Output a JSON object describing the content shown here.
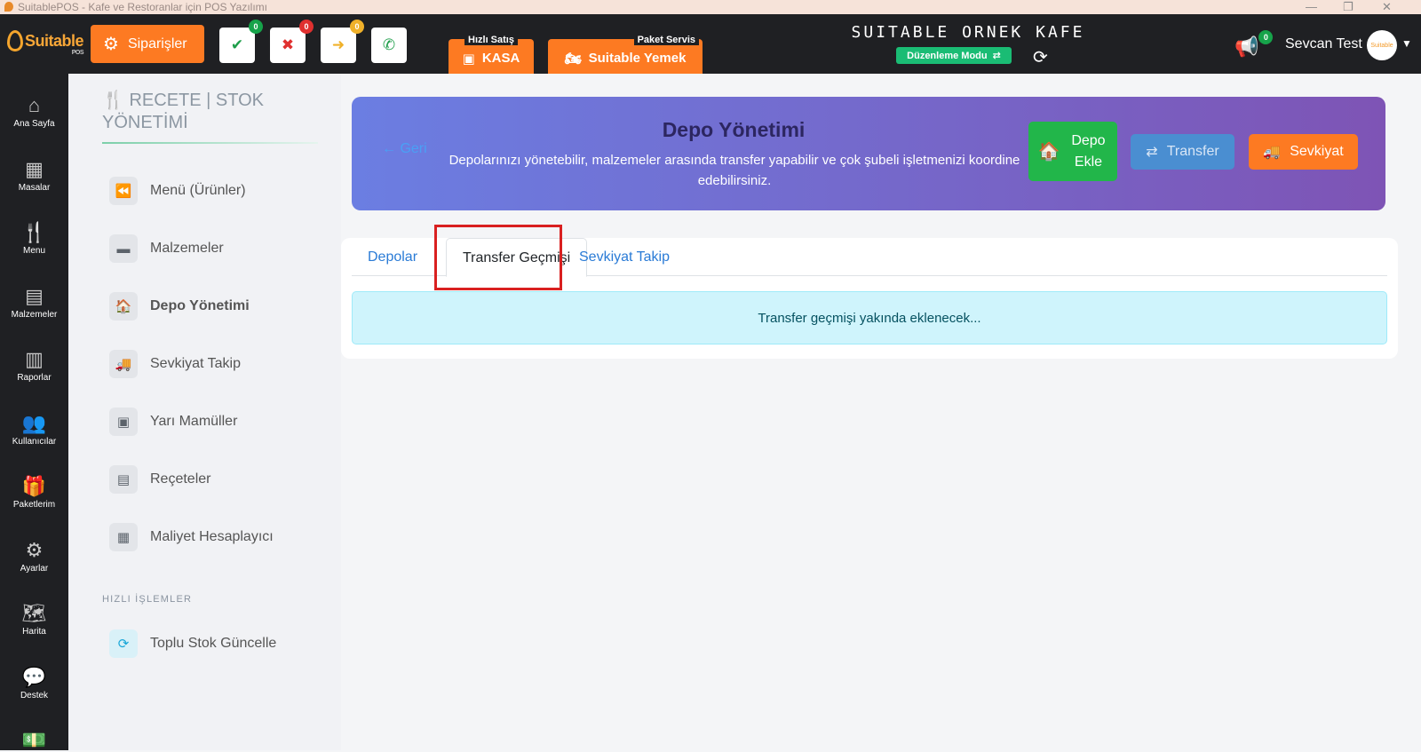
{
  "window": {
    "title": "SuitablePOS - Kafe ve Restoranlar için POS Yazılımı"
  },
  "header": {
    "logo_text": "Suitable",
    "logo_sub": "POS",
    "orders_label": "Siparişler",
    "status_buttons": [
      {
        "name": "approved",
        "glyph": "✔",
        "color": "#1e9e4a",
        "badge": "0",
        "badge_color": "#16a34a"
      },
      {
        "name": "cancelled",
        "glyph": "✖",
        "color": "#e0302f",
        "badge": "0",
        "badge_color": "#e0302f"
      },
      {
        "name": "pending",
        "glyph": "➜",
        "color": "#f0b12a",
        "badge": "0",
        "badge_color": "#f0b12a"
      },
      {
        "name": "phone",
        "glyph": "✆",
        "color": "#1e9e4a"
      }
    ],
    "kasa_caption": "Hızlı Satış",
    "kasa_label": "KASA",
    "yemek_caption": "Paket Servis",
    "yemek_label": "Suitable Yemek",
    "cafe_name": "SUITABLE ORNEK KAFE",
    "edit_mode_label": "Düzenleme Modu",
    "notification_count": "0",
    "user_name": "Sevcan Test",
    "avatar_text": "Suitable"
  },
  "leftnav": [
    {
      "label": "Ana Sayfa",
      "icon": "⌂",
      "name": "home"
    },
    {
      "label": "Masalar",
      "icon": "▦",
      "name": "tables"
    },
    {
      "label": "Menu",
      "icon": "🍴",
      "name": "menu"
    },
    {
      "label": "Malzemeler",
      "icon": "▤",
      "name": "ingredients"
    },
    {
      "label": "Raporlar",
      "icon": "▥",
      "name": "reports"
    },
    {
      "label": "Kullanıcılar",
      "icon": "👥",
      "name": "users"
    },
    {
      "label": "Paketlerim",
      "icon": "🎁",
      "name": "packages"
    },
    {
      "label": "Ayarlar",
      "icon": "⚙",
      "name": "settings"
    },
    {
      "label": "Harita",
      "icon": "🗺",
      "name": "map"
    },
    {
      "label": "Destek",
      "icon": "💬",
      "name": "support"
    },
    {
      "label": "",
      "icon": "💵",
      "name": "cash"
    }
  ],
  "submenu": {
    "title": "RECETE | STOK YÖNETİMİ",
    "items": [
      {
        "label": "Menü (Ürünler)",
        "icon": "⏪",
        "name": "menu-products"
      },
      {
        "label": "Malzemeler",
        "icon": "▬",
        "name": "ingredients"
      },
      {
        "label": "Depo Yönetimi",
        "icon": "🏠",
        "name": "warehouse",
        "active": true
      },
      {
        "label": "Sevkiyat Takip",
        "icon": "🚚",
        "name": "shipment"
      },
      {
        "label": "Yarı Mamüller",
        "icon": "▣",
        "name": "semi-products"
      },
      {
        "label": "Reçeteler",
        "icon": "▤",
        "name": "recipes"
      },
      {
        "label": "Maliyet Hesaplayıcı",
        "icon": "▦",
        "name": "cost-calculator"
      }
    ],
    "section_label": "HIZLI İŞLEMLER",
    "quick_items": [
      {
        "label": "Toplu Stok Güncelle",
        "icon": "⟳",
        "name": "bulk-stock-update"
      }
    ]
  },
  "hero": {
    "back_label": "← Geri",
    "title": "Depo Yönetimi",
    "description": "Depolarınızı yönetebilir, malzemeler arasında transfer yapabilir ve çok şubeli işletmenizi koordine edebilirsiniz.",
    "add_warehouse_label": "Depo Ekle",
    "transfer_label": "Transfer",
    "shipment_label": "Sevkiyat"
  },
  "tabs": [
    {
      "label": "Depolar",
      "name": "depolar"
    },
    {
      "label": "Transfer Geçmişi",
      "name": "transfer-gecmisi",
      "active": true
    },
    {
      "label": "Sevkiyat Takip",
      "name": "sevkiyat-takip"
    }
  ],
  "info_message": "Transfer geçmişi yakında eklenecek...",
  "colors": {
    "accent": "#fd7a22",
    "sidebar": "#1f2023",
    "success": "#22b64a",
    "info_bg": "#cff4fc",
    "highlight": "#d92020"
  }
}
